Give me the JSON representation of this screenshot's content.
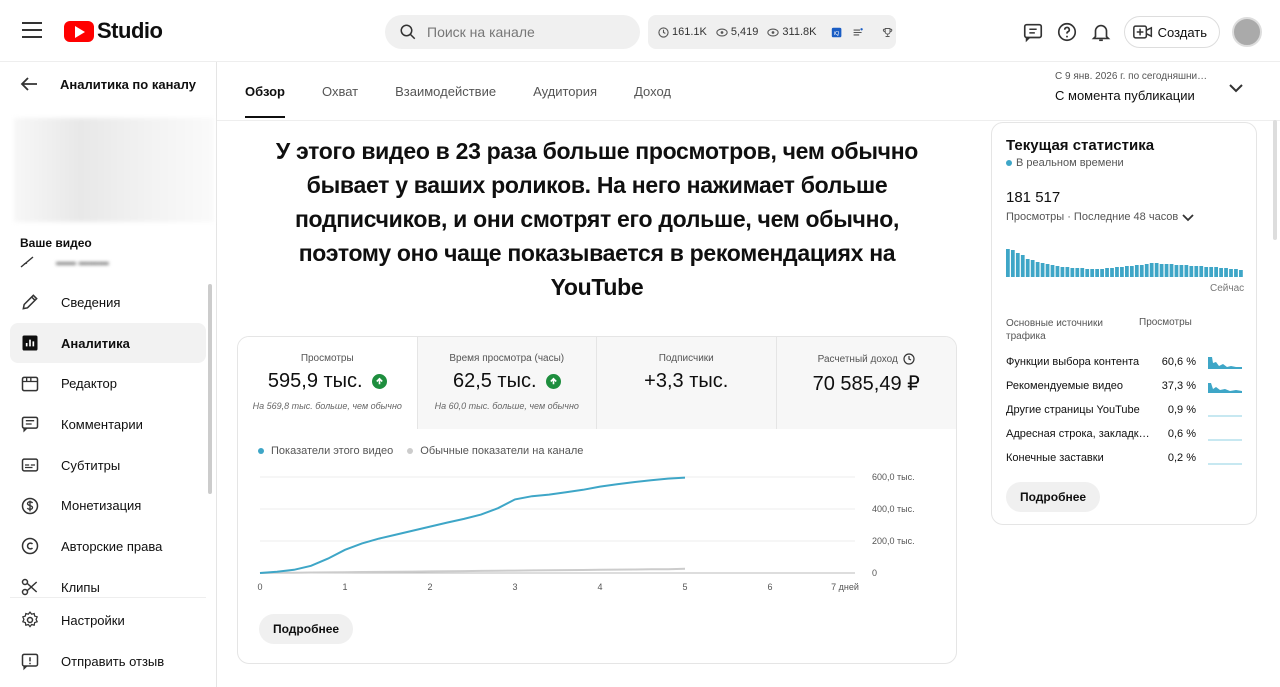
{
  "header": {
    "logo_text": "Studio",
    "search_placeholder": "Поиск на канале",
    "stats": [
      "161.1K",
      "5,419",
      "311.8K"
    ],
    "create_label": "Создать"
  },
  "sidebar": {
    "back_label": "Аналитика по каналу",
    "your_video_label": "Ваше видео",
    "items": [
      {
        "label": "Сведения",
        "icon": "pencil-icon"
      },
      {
        "label": "Аналитика",
        "icon": "analytics-icon"
      },
      {
        "label": "Редактор",
        "icon": "editor-icon"
      },
      {
        "label": "Комментарии",
        "icon": "comment-icon"
      },
      {
        "label": "Субтитры",
        "icon": "subtitles-icon"
      },
      {
        "label": "Монетизация",
        "icon": "dollar-icon"
      },
      {
        "label": "Авторские права",
        "icon": "copyright-icon"
      },
      {
        "label": "Клипы",
        "icon": "scissors-icon"
      }
    ],
    "bottom_items": [
      {
        "label": "Настройки",
        "icon": "gear-icon"
      },
      {
        "label": "Отправить отзыв",
        "icon": "feedback-icon"
      }
    ]
  },
  "tabs": [
    "Обзор",
    "Охват",
    "Взаимодействие",
    "Аудитория",
    "Доход"
  ],
  "date_range": {
    "line1": "С 9 янв. 2026 г. по сегодняшни…",
    "line2": "С момента публикации"
  },
  "headline": "У этого видео в 23 раза больше просмотров, чем обычно бывает у ваших роликов. На него нажимает больше подписчиков, и они смотрят его дольше, чем обычно, поэтому оно чаще показывается в рекомендациях на YouTube",
  "metrics": [
    {
      "label": "Просмотры",
      "value": "595,9 тыс.",
      "sub": "На 569,8 тыс. больше, чем обычно"
    },
    {
      "label": "Время просмотра (часы)",
      "value": "62,5 тыс.",
      "sub": "На 60,0 тыс. больше, чем обычно"
    },
    {
      "label": "Подписчики",
      "value": "+3,3 тыс.",
      "sub": ""
    },
    {
      "label": "Расчетный доход",
      "value": "70 585,49 ₽",
      "sub": ""
    }
  ],
  "more_label": "Подробнее",
  "chart_data": {
    "type": "line",
    "x": [
      0,
      0.2,
      0.4,
      0.6,
      0.8,
      1,
      1.2,
      1.4,
      1.6,
      1.8,
      2,
      2.2,
      2.4,
      2.6,
      2.8,
      3,
      3.2,
      3.4,
      3.6,
      3.8,
      4,
      4.2,
      4.4,
      4.6,
      4.8,
      5
    ],
    "series": [
      {
        "name": "Показатели этого видео",
        "color": "#3ea6c7",
        "values": [
          0,
          8,
          20,
          45,
          90,
          145,
          185,
          215,
          240,
          265,
          290,
          315,
          338,
          365,
          405,
          460,
          480,
          490,
          505,
          520,
          540,
          555,
          568,
          580,
          590,
          596
        ]
      },
      {
        "name": "Обычные показатели на канале",
        "color": "#cccccc",
        "values": [
          0,
          1,
          2,
          3,
          4,
          5,
          6,
          7,
          8,
          9,
          10,
          11,
          12,
          13,
          14,
          15,
          16,
          17,
          18,
          19,
          20,
          21,
          22,
          23,
          24,
          26
        ]
      }
    ],
    "xticks": [
      "0",
      "1",
      "2",
      "3",
      "4",
      "5",
      "6",
      "7 дней"
    ],
    "yticks": [
      "0",
      "200,0 тыс.",
      "400,0 тыс.",
      "600,0 тыс."
    ],
    "xlim": [
      0,
      7
    ],
    "ylim": [
      0,
      600
    ]
  },
  "realtime": {
    "title": "Текущая статистика",
    "live_label": "В реальном времени",
    "value": "181 517",
    "period": "Просмотры · Последние 48 часов",
    "now_label": "Сейчас",
    "bars": [
      28,
      27,
      24,
      22,
      18,
      17,
      15,
      14,
      13,
      12,
      11,
      10,
      10,
      9,
      9,
      9,
      8,
      8,
      8,
      8,
      9,
      9,
      10,
      10,
      11,
      11,
      12,
      12,
      13,
      14,
      14,
      13,
      13,
      13,
      12,
      12,
      12,
      11,
      11,
      11,
      10,
      10,
      10,
      9,
      9,
      8,
      8,
      7
    ],
    "col1": "Основные источники трафика",
    "col2": "Просмотры",
    "sources": [
      {
        "name": "Функции выбора контента",
        "pct": "60,6 %"
      },
      {
        "name": "Рекомендуемые видео",
        "pct": "37,3 %"
      },
      {
        "name": "Другие страницы YouTube",
        "pct": "0,9 %"
      },
      {
        "name": "Адресная строка, закладк…",
        "pct": "0,6 %"
      },
      {
        "name": "Конечные заставки",
        "pct": "0,2 %"
      }
    ]
  }
}
